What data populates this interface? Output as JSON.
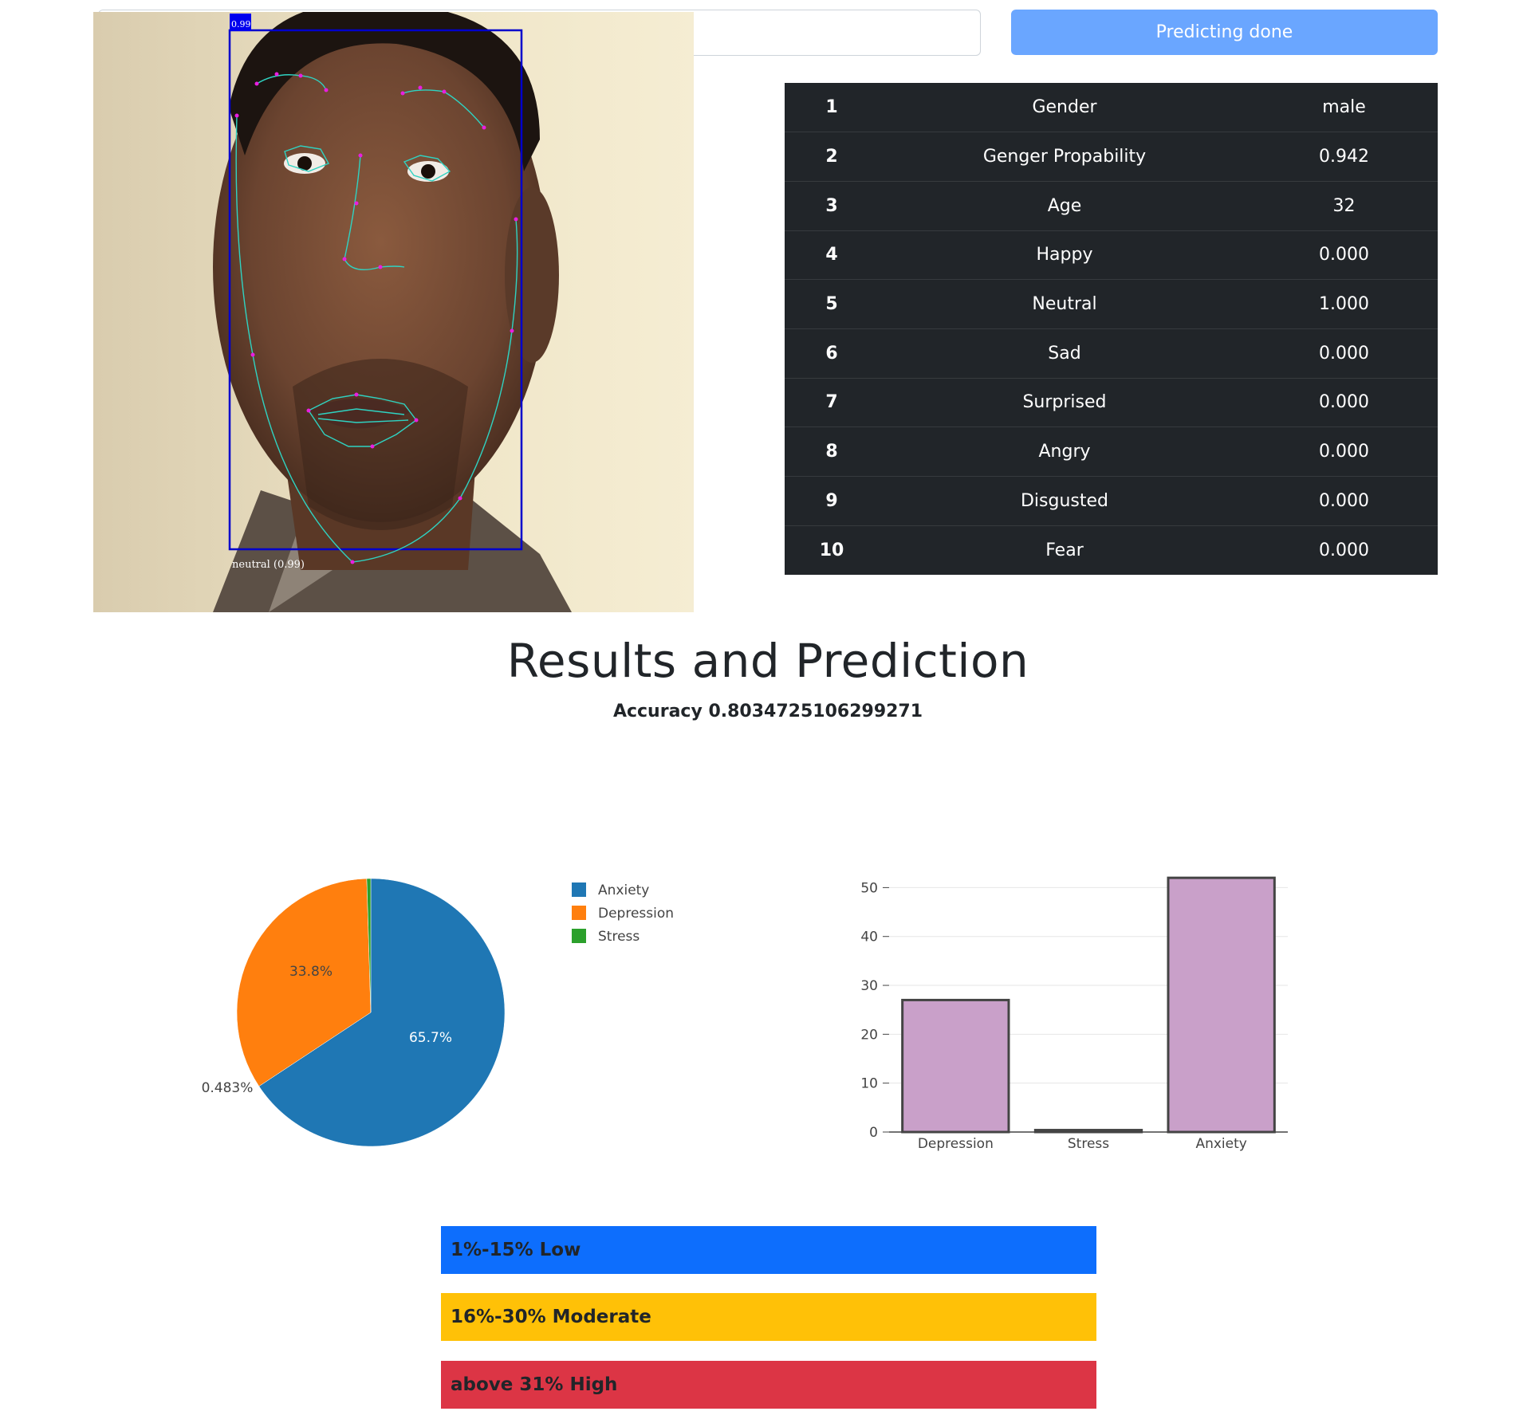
{
  "upload": {
    "predict_button": "Predicting done"
  },
  "photo": {
    "box_score": "0.99",
    "label": "neutral (0.99)"
  },
  "results": [
    {
      "idx": "1",
      "name": "Gender",
      "value": "male"
    },
    {
      "idx": "2",
      "name": "Genger Propability",
      "value": "0.942"
    },
    {
      "idx": "3",
      "name": "Age",
      "value": "32"
    },
    {
      "idx": "4",
      "name": "Happy",
      "value": "0.000"
    },
    {
      "idx": "5",
      "name": "Neutral",
      "value": "1.000"
    },
    {
      "idx": "6",
      "name": "Sad",
      "value": "0.000"
    },
    {
      "idx": "7",
      "name": "Surprised",
      "value": "0.000"
    },
    {
      "idx": "8",
      "name": "Angry",
      "value": "0.000"
    },
    {
      "idx": "9",
      "name": "Disgusted",
      "value": "0.000"
    },
    {
      "idx": "10",
      "name": "Fear",
      "value": "0.000"
    }
  ],
  "heading": "Results and Prediction",
  "accuracy": "Accuracy 0.8034725106299271",
  "chart_data": [
    {
      "type": "pie",
      "labels": [
        "Anxiety",
        "Depression",
        "Stress"
      ],
      "values": [
        65.7,
        33.8,
        0.483
      ],
      "slice_labels": [
        "65.7%",
        "33.8%",
        "0.483%"
      ],
      "colors": [
        "#1f77b4",
        "#ff7f0e",
        "#2ca02c"
      ],
      "legend_position": "right"
    },
    {
      "type": "bar",
      "categories": [
        "Depression",
        "Stress",
        "Anxiety"
      ],
      "values": [
        27,
        0.4,
        52
      ],
      "ylim": [
        0,
        53
      ],
      "yticks": [
        "0",
        "10",
        "20",
        "30",
        "40",
        "50"
      ],
      "bar_color": "#c9a0c9",
      "grid": true
    }
  ],
  "levels": {
    "low": "1%-15% Low",
    "moderate": "16%-30% Moderate",
    "high": "above 31% High"
  }
}
